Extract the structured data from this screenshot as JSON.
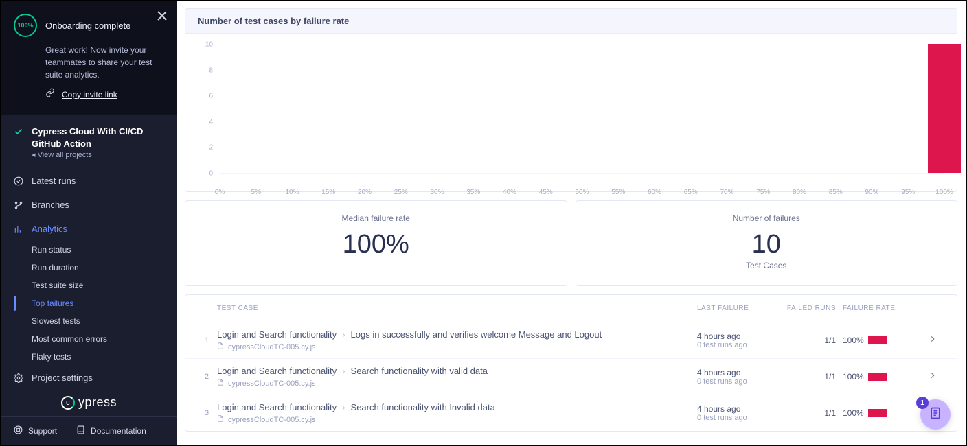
{
  "onboarding": {
    "progress": "100%",
    "title": "Onboarding complete",
    "subtitle": "Great work! Now invite your teammates to share your test suite analytics.",
    "invite_label": "Copy invite link"
  },
  "project": {
    "name": "Cypress Cloud With CI/CD GitHub Action",
    "view_all": "View all projects"
  },
  "nav": {
    "latest_runs": "Latest runs",
    "branches": "Branches",
    "analytics": "Analytics",
    "project_settings": "Project settings"
  },
  "analytics_sub": {
    "run_status": "Run status",
    "run_duration": "Run duration",
    "test_suite_size": "Test suite size",
    "top_failures": "Top failures",
    "slowest_tests": "Slowest tests",
    "most_common_errors": "Most common errors",
    "flaky_tests": "Flaky tests"
  },
  "brand": "cypress",
  "footer": {
    "support": "Support",
    "documentation": "Documentation"
  },
  "chart": {
    "title": "Number of test cases by failure rate"
  },
  "chart_data": {
    "type": "bar",
    "title": "Number of test cases by failure rate",
    "xlabel": "",
    "ylabel": "",
    "ylim": [
      0,
      10
    ],
    "y_ticks": [
      0,
      2,
      4,
      6,
      8,
      10
    ],
    "categories": [
      "0%",
      "5%",
      "10%",
      "15%",
      "20%",
      "25%",
      "30%",
      "35%",
      "40%",
      "45%",
      "50%",
      "55%",
      "60%",
      "65%",
      "70%",
      "75%",
      "80%",
      "85%",
      "90%",
      "95%",
      "100%"
    ],
    "values": [
      0,
      0,
      0,
      0,
      0,
      0,
      0,
      0,
      0,
      0,
      0,
      0,
      0,
      0,
      0,
      0,
      0,
      0,
      0,
      0,
      10
    ],
    "bar_color": "#dd164e"
  },
  "stats": {
    "median_label": "Median failure rate",
    "median_value": "100%",
    "failures_label": "Number of failures",
    "failures_value": "10",
    "failures_sub": "Test Cases"
  },
  "table": {
    "headers": {
      "test_case": "TEST CASE",
      "last_failure": "LAST FAILURE",
      "failed_runs": "FAILED RUNS",
      "failure_rate": "FAILURE RATE"
    },
    "rows": [
      {
        "index": "1",
        "group": "Login and Search functionality",
        "name": "Logs in successfully and verifies welcome Message and Logout",
        "file": "cypressCloudTC-005.cy.js",
        "last_main": "4 hours ago",
        "last_sub": "0 test runs ago",
        "failed_runs": "1/1",
        "rate_pct": "100%"
      },
      {
        "index": "2",
        "group": "Login and Search functionality",
        "name": "Search functionality with valid data",
        "file": "cypressCloudTC-005.cy.js",
        "last_main": "4 hours ago",
        "last_sub": "0 test runs ago",
        "failed_runs": "1/1",
        "rate_pct": "100%"
      },
      {
        "index": "3",
        "group": "Login and Search functionality",
        "name": "Search functionality with Invalid data",
        "file": "cypressCloudTC-005.cy.js",
        "last_main": "4 hours ago",
        "last_sub": "0 test runs ago",
        "failed_runs": "1/1",
        "rate_pct": "100%"
      }
    ]
  },
  "fab": {
    "badge": "1"
  }
}
